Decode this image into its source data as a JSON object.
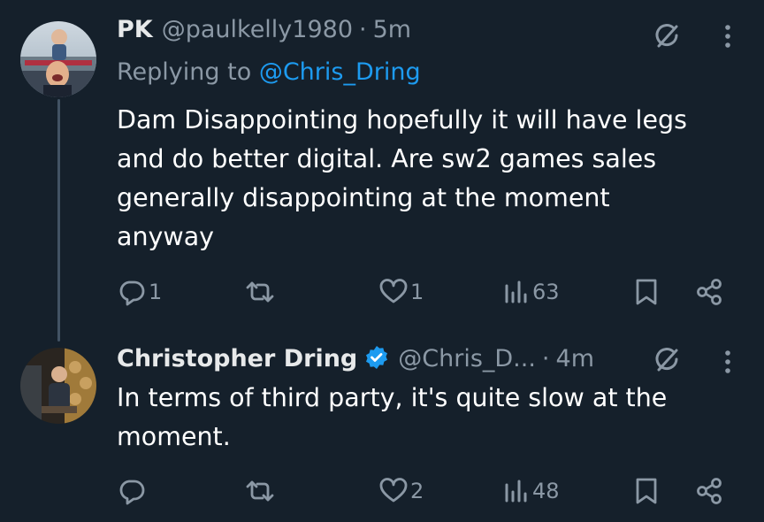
{
  "tweets": [
    {
      "name": "PK",
      "handle": "@paulkelly1980",
      "separator": "·",
      "time": "5m",
      "replying_prefix": "Replying to",
      "replying_mention": "@Chris_Dring",
      "body_lines": [
        "Dam Disappointing hopefully it will have legs",
        "and do better digital. Are sw2 games sales",
        "generally disappointing at the moment",
        "anyway"
      ],
      "replies": "1",
      "retweets": "",
      "likes": "1",
      "views": "63"
    },
    {
      "name": "Christopher Dring",
      "handle": "@Chris_D...",
      "separator": "·",
      "time": "4m",
      "body_lines": [
        "In terms of third party, it's quite slow at the",
        "moment."
      ],
      "replies": "",
      "retweets": "",
      "likes": "2",
      "views": "48"
    }
  ],
  "icons": {
    "muted": "grok-icon",
    "more": "more-vertical-icon",
    "reply": "reply-icon",
    "retweet": "retweet-icon",
    "like": "heart-icon",
    "views": "views-icon",
    "bookmark": "bookmark-icon",
    "share": "share-icon",
    "verified": "verified-badge-icon"
  },
  "colors": {
    "background": "#15202b",
    "text": "#e7e9ea",
    "secondary": "#8b98a5",
    "link": "#1d9bf0",
    "verified": "#1d9bf0",
    "thread_line": "#425364"
  }
}
